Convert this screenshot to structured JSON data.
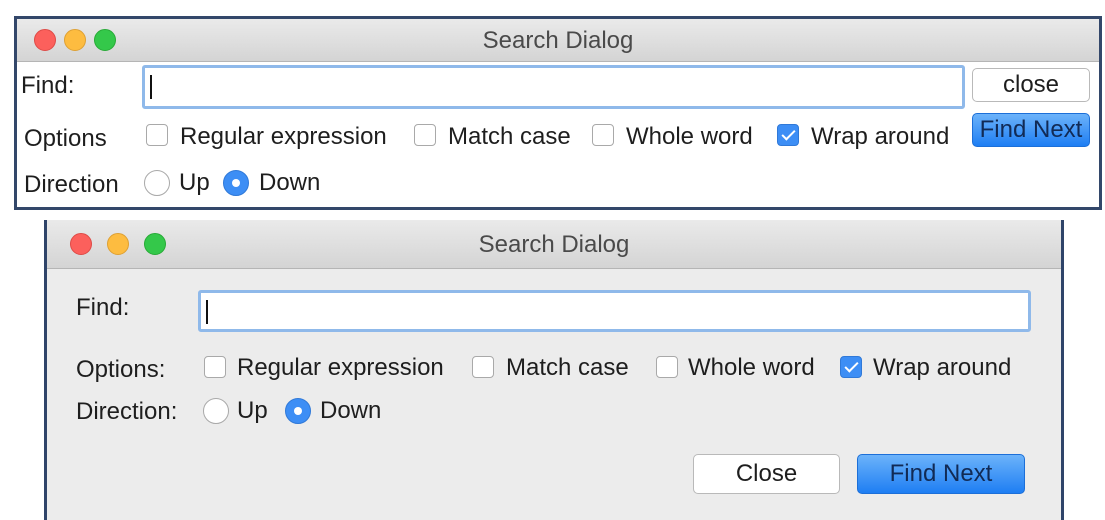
{
  "dialog_top": {
    "title": "Search Dialog",
    "find_label": "Find:",
    "find_value": "",
    "close_label": "close",
    "options_label": "Options",
    "find_next_label": "Find Next",
    "direction_label": "Direction",
    "options": [
      {
        "label": "Regular expression",
        "checked": false
      },
      {
        "label": "Match case",
        "checked": false
      },
      {
        "label": "Whole word",
        "checked": false
      },
      {
        "label": "Wrap around",
        "checked": true
      }
    ],
    "direction": [
      {
        "label": "Up",
        "selected": false
      },
      {
        "label": "Down",
        "selected": true
      }
    ]
  },
  "dialog_bottom": {
    "title": "Search Dialog",
    "find_label": "Find:",
    "find_value": "",
    "options_label": "Options:",
    "direction_label": "Direction:",
    "options": [
      {
        "label": "Regular expression",
        "checked": false
      },
      {
        "label": "Match case",
        "checked": false
      },
      {
        "label": "Whole word",
        "checked": false
      },
      {
        "label": "Wrap around",
        "checked": true
      }
    ],
    "direction": [
      {
        "label": "Up",
        "selected": false
      },
      {
        "label": "Down",
        "selected": true
      }
    ],
    "close_label": "Close",
    "find_next_label": "Find Next"
  },
  "colors": {
    "accent": "#3d8ef5",
    "close_red": "#fc605c",
    "minimize_yellow": "#fdbc40",
    "zoom_green": "#34c84a"
  }
}
